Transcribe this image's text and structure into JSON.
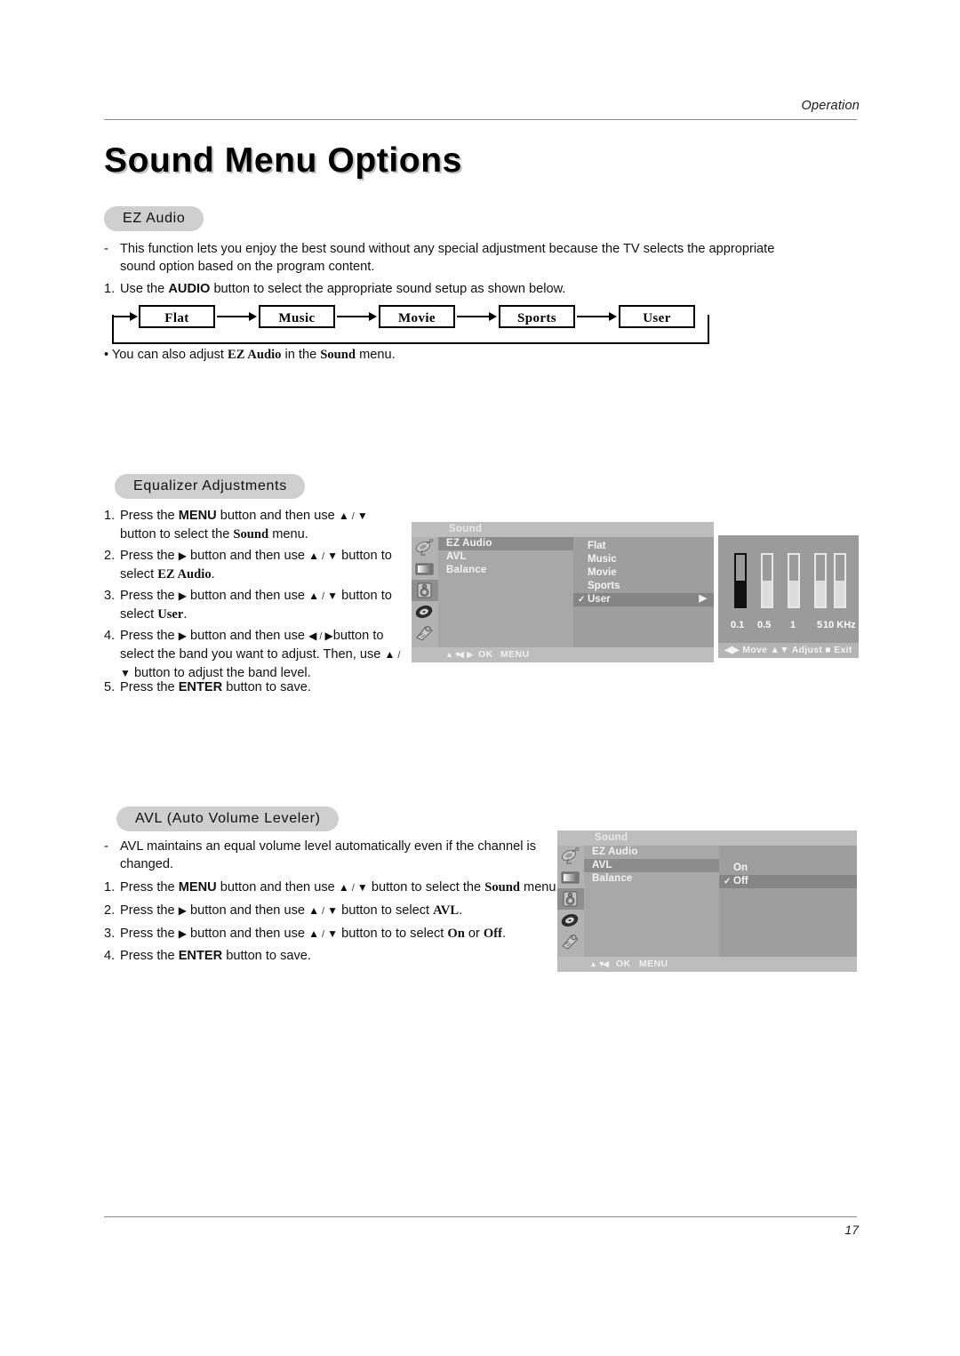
{
  "header": {
    "section_label": "Operation"
  },
  "page_title": "Sound Menu Options",
  "ez_audio": {
    "pill_label": "EZ Audio",
    "description_mark": "-",
    "description": "This function lets you enjoy the best sound without any special adjustment because the TV selects the appropriate sound option based on the program content.",
    "step1_mark": "1.",
    "step1_pre": "Use the ",
    "step1_bold": "AUDIO",
    "step1_post": " button to select the appropriate sound setup as shown below.",
    "flow_boxes": [
      "Flat",
      "Music",
      "Movie",
      "Sports",
      "User"
    ],
    "note_bullet": "•",
    "note_pre": "You can also adjust ",
    "note_bold1": "EZ Audio",
    "note_mid": " in the ",
    "note_bold2": "Sound",
    "note_post": " menu."
  },
  "equalizer": {
    "pill_label": "Equalizer Adjustments",
    "steps": [
      {
        "num": "1.",
        "parts": [
          "Press the ",
          "MENU",
          " button and then use ",
          "▲",
          " / ",
          "▼",
          "  button to select the ",
          "Sound",
          " menu."
        ]
      },
      {
        "num": "2.",
        "parts": [
          "Press the ",
          "▶",
          "  button and then use ",
          "▲",
          " / ",
          "▼",
          " button to select ",
          "EZ Audio",
          "."
        ]
      },
      {
        "num": "3.",
        "parts": [
          "Press the ",
          "▶",
          "  button and then use ",
          "▲",
          " / ",
          "▼",
          " button to select ",
          "User",
          "."
        ]
      },
      {
        "num": "4.",
        "parts": [
          "Press the ",
          "▶",
          "  button and then use ",
          "◀",
          " / ",
          "▶",
          "button to select the band you want to adjust. Then, use ",
          "▲",
          " / ",
          "▼",
          " button to adjust the band level."
        ]
      },
      {
        "num": "5.",
        "parts": [
          "Press the ",
          "ENTER",
          " button to save."
        ]
      }
    ],
    "osd": {
      "title": "Sound",
      "menu_items": [
        {
          "label": "EZ Audio",
          "highlighted": true
        },
        {
          "label": "AVL",
          "highlighted": false
        },
        {
          "label": "Balance",
          "highlighted": false
        }
      ],
      "sub_items": [
        {
          "label": "Flat",
          "checked": false,
          "highlighted": false,
          "arrow": false
        },
        {
          "label": "Music",
          "checked": false,
          "highlighted": false,
          "arrow": false
        },
        {
          "label": "Movie",
          "checked": false,
          "highlighted": false,
          "arrow": false
        },
        {
          "label": "Sports",
          "checked": false,
          "highlighted": false,
          "arrow": false
        },
        {
          "label": "User",
          "checked": true,
          "highlighted": true,
          "arrow": true
        }
      ],
      "check_glyph": "✓",
      "arrow_glyph": "▶",
      "footer": {
        "updown": "▲▼",
        "leftright": "◀ ▶",
        "ok": "OK",
        "menu": "MENU"
      },
      "icons": [
        "satellite-dish-icon",
        "picture-screen-icon",
        "speaker-sound-icon",
        "clock-timer-icon",
        "remote-control-icon"
      ],
      "selected_icon_index": 2
    },
    "eq_panel": {
      "bands": [
        {
          "label": "0.1",
          "level": 50,
          "selected": true
        },
        {
          "label": "0.5",
          "level": 50,
          "selected": false
        },
        {
          "label": "1",
          "level": 50,
          "selected": false
        },
        {
          "label": "5",
          "level": 50,
          "selected": false
        },
        {
          "label": "10 KHz",
          "level": 50,
          "selected": false
        }
      ],
      "footer": "◀▶ Move ▲▼ Adjust ■ Exit",
      "foot_move": "Move",
      "foot_adjust": "Adjust",
      "foot_exit": "Exit"
    }
  },
  "avl": {
    "pill_label": "AVL (Auto Volume Leveler)",
    "description_mark": "-",
    "description": "AVL maintains an equal volume level automatically even if the channel is changed.",
    "steps": [
      {
        "num": "1.",
        "parts": [
          "Press the ",
          "MENU",
          " button and then use ",
          "▲",
          " / ",
          "▼",
          " button to select the ",
          "Sound",
          " menu."
        ]
      },
      {
        "num": "2.",
        "parts": [
          "Press the ",
          "▶",
          "  button and then use ",
          "▲",
          " / ",
          "▼",
          " button to select ",
          "AVL",
          "."
        ]
      },
      {
        "num": "3.",
        "parts": [
          "Press the ",
          "▶",
          "  button and then use ",
          "▲",
          " / ",
          "▼",
          " button to to select ",
          "On",
          " or ",
          "Off",
          "."
        ]
      },
      {
        "num": "4.",
        "parts": [
          "Press the ",
          "ENTER",
          " button to save."
        ]
      }
    ],
    "osd": {
      "title": "Sound",
      "menu_items": [
        {
          "label": "EZ Audio",
          "highlighted": false
        },
        {
          "label": "AVL",
          "highlighted": true
        },
        {
          "label": "Balance",
          "highlighted": false
        }
      ],
      "sub_items": [
        {
          "label": "On",
          "checked": false,
          "highlighted": false
        },
        {
          "label": "Off",
          "checked": true,
          "highlighted": true
        }
      ],
      "check_glyph": "✓",
      "footer": {
        "updown": "▲▼",
        "left": "◀",
        "ok": "OK",
        "menu": "MENU"
      },
      "icons": [
        "satellite-dish-icon",
        "picture-screen-icon",
        "speaker-sound-icon",
        "clock-timer-icon",
        "remote-control-icon"
      ],
      "selected_icon_index": 2
    }
  },
  "footer": {
    "page_number": "17"
  },
  "colors": {
    "pill_bg": "#cfcfcf",
    "osd_bg": "#a8a8a8",
    "osd_header": "#bdbdbd",
    "osd_highlight": "#8c8c8c",
    "rule": "#8a8a8a"
  }
}
